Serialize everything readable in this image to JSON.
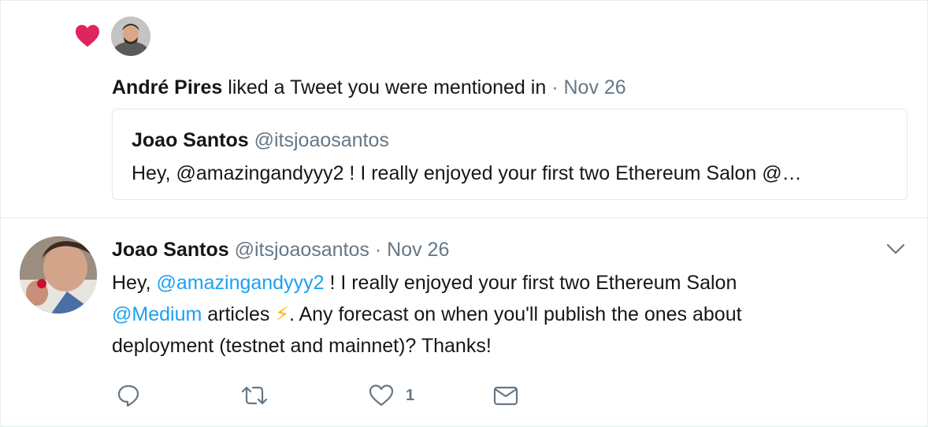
{
  "notification": {
    "icon": "heart-icon",
    "liker_name": "André Pires",
    "action_text": "liked a Tweet you were mentioned in",
    "separator": "·",
    "date": "Nov 26",
    "quoted": {
      "author_name": "Joao Santos",
      "author_handle": "@itsjoaosantos",
      "text": "Hey, @amazingandyyy2 ! I really enjoyed your first two Ethereum Salon @…"
    }
  },
  "tweet": {
    "author_name": "Joao Santos",
    "author_handle": "@itsjoaosantos",
    "separator": "·",
    "date": "Nov 26",
    "body": {
      "t1": "Hey, ",
      "mention1": "@amazingandyyy2",
      "t2": " ! I really enjoyed your first two Ethereum Salon",
      "mention2": "@Medium",
      "t3": " articles ",
      "emoji": "⚡",
      "t4": ". Any forecast on when you'll publish the ones about",
      "t5": "deployment (testnet and mainnet)? Thanks!"
    },
    "actions": {
      "reply_icon": "reply-icon",
      "retweet_icon": "retweet-icon",
      "like_icon": "like-icon",
      "like_count": "1",
      "dm_icon": "direct-message-icon"
    }
  },
  "colors": {
    "heart": "#e0245e",
    "link": "#1da1f2",
    "muted": "#657786",
    "border": "#e1e8ed"
  }
}
